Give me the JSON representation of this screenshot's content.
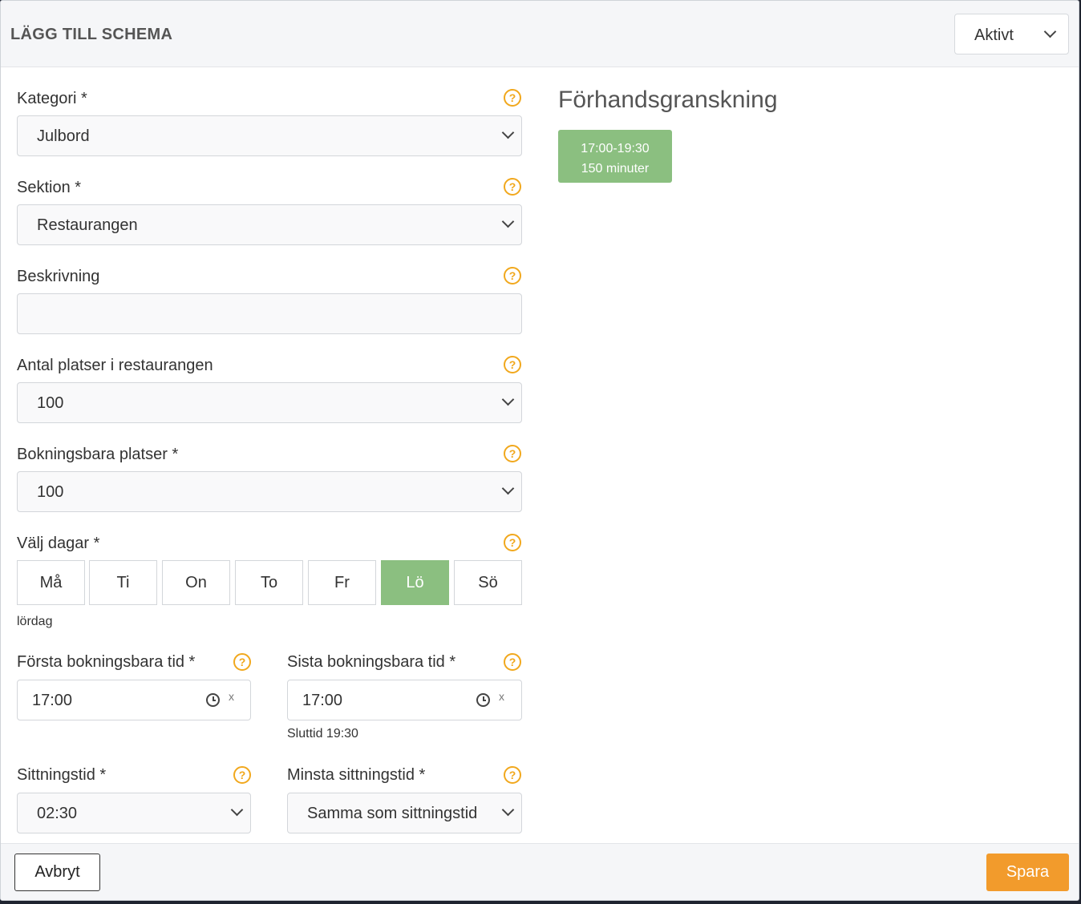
{
  "header": {
    "title": "LÄGG TILL SCHEMA",
    "status_value": "Aktivt"
  },
  "form": {
    "kategori": {
      "label": "Kategori *",
      "value": "Julbord"
    },
    "sektion": {
      "label": "Sektion *",
      "value": "Restaurangen"
    },
    "beskrivning": {
      "label": "Beskrivning",
      "value": ""
    },
    "antal_platser": {
      "label": "Antal platser i restaurangen",
      "value": "100"
    },
    "bokningsbara_platser": {
      "label": "Bokningsbara platser *",
      "value": "100"
    },
    "dagar": {
      "label": "Välj dagar *",
      "days": [
        "Må",
        "Ti",
        "On",
        "To",
        "Fr",
        "Lö",
        "Sö"
      ],
      "selected": [
        "Lö"
      ],
      "selected_text": "lördag"
    },
    "forsta_tid": {
      "label": "Första bokningsbara tid *",
      "value": "17:00",
      "clear": "x"
    },
    "sista_tid": {
      "label": "Sista bokningsbara tid *",
      "value": "17:00",
      "clear": "x",
      "hint": "Sluttid 19:30"
    },
    "sittningstid": {
      "label": "Sittningstid *",
      "value": "02:30"
    },
    "minsta_sittningstid": {
      "label": "Minsta sittningstid *",
      "value": "Samma som sittningstid"
    },
    "help_glyph": "?"
  },
  "preview": {
    "title": "Förhandsgranskning",
    "slot_time": "17:00-19:30",
    "slot_duration": "150 minuter"
  },
  "footer": {
    "cancel_label": "Avbryt",
    "save_label": "Spara"
  },
  "colors": {
    "accent_green": "#8bbf80",
    "save_orange": "#f29b2c",
    "help_orange": "#f1a81d"
  }
}
